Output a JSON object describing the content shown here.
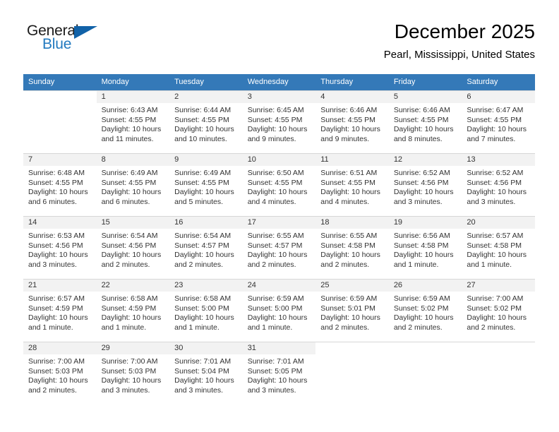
{
  "brand": {
    "name_top": "General",
    "name_bottom": "Blue",
    "accent_color": "#1162a8",
    "blue_text_color": "#2179bf"
  },
  "header": {
    "title": "December 2025",
    "subtitle": "Pearl, Mississippi, United States"
  },
  "calendar": {
    "header_bg": "#3479b8",
    "header_text_color": "#ffffff",
    "daynum_bg": "#f2f2f2",
    "weekday_headers": [
      "Sunday",
      "Monday",
      "Tuesday",
      "Wednesday",
      "Thursday",
      "Friday",
      "Saturday"
    ],
    "weeks": [
      [
        {
          "day": "",
          "lines": []
        },
        {
          "day": "1",
          "lines": [
            "Sunrise: 6:43 AM",
            "Sunset: 4:55 PM",
            "Daylight: 10 hours",
            "and 11 minutes."
          ]
        },
        {
          "day": "2",
          "lines": [
            "Sunrise: 6:44 AM",
            "Sunset: 4:55 PM",
            "Daylight: 10 hours",
            "and 10 minutes."
          ]
        },
        {
          "day": "3",
          "lines": [
            "Sunrise: 6:45 AM",
            "Sunset: 4:55 PM",
            "Daylight: 10 hours",
            "and 9 minutes."
          ]
        },
        {
          "day": "4",
          "lines": [
            "Sunrise: 6:46 AM",
            "Sunset: 4:55 PM",
            "Daylight: 10 hours",
            "and 9 minutes."
          ]
        },
        {
          "day": "5",
          "lines": [
            "Sunrise: 6:46 AM",
            "Sunset: 4:55 PM",
            "Daylight: 10 hours",
            "and 8 minutes."
          ]
        },
        {
          "day": "6",
          "lines": [
            "Sunrise: 6:47 AM",
            "Sunset: 4:55 PM",
            "Daylight: 10 hours",
            "and 7 minutes."
          ]
        }
      ],
      [
        {
          "day": "7",
          "lines": [
            "Sunrise: 6:48 AM",
            "Sunset: 4:55 PM",
            "Daylight: 10 hours",
            "and 6 minutes."
          ]
        },
        {
          "day": "8",
          "lines": [
            "Sunrise: 6:49 AM",
            "Sunset: 4:55 PM",
            "Daylight: 10 hours",
            "and 6 minutes."
          ]
        },
        {
          "day": "9",
          "lines": [
            "Sunrise: 6:49 AM",
            "Sunset: 4:55 PM",
            "Daylight: 10 hours",
            "and 5 minutes."
          ]
        },
        {
          "day": "10",
          "lines": [
            "Sunrise: 6:50 AM",
            "Sunset: 4:55 PM",
            "Daylight: 10 hours",
            "and 4 minutes."
          ]
        },
        {
          "day": "11",
          "lines": [
            "Sunrise: 6:51 AM",
            "Sunset: 4:55 PM",
            "Daylight: 10 hours",
            "and 4 minutes."
          ]
        },
        {
          "day": "12",
          "lines": [
            "Sunrise: 6:52 AM",
            "Sunset: 4:56 PM",
            "Daylight: 10 hours",
            "and 3 minutes."
          ]
        },
        {
          "day": "13",
          "lines": [
            "Sunrise: 6:52 AM",
            "Sunset: 4:56 PM",
            "Daylight: 10 hours",
            "and 3 minutes."
          ]
        }
      ],
      [
        {
          "day": "14",
          "lines": [
            "Sunrise: 6:53 AM",
            "Sunset: 4:56 PM",
            "Daylight: 10 hours",
            "and 3 minutes."
          ]
        },
        {
          "day": "15",
          "lines": [
            "Sunrise: 6:54 AM",
            "Sunset: 4:56 PM",
            "Daylight: 10 hours",
            "and 2 minutes."
          ]
        },
        {
          "day": "16",
          "lines": [
            "Sunrise: 6:54 AM",
            "Sunset: 4:57 PM",
            "Daylight: 10 hours",
            "and 2 minutes."
          ]
        },
        {
          "day": "17",
          "lines": [
            "Sunrise: 6:55 AM",
            "Sunset: 4:57 PM",
            "Daylight: 10 hours",
            "and 2 minutes."
          ]
        },
        {
          "day": "18",
          "lines": [
            "Sunrise: 6:55 AM",
            "Sunset: 4:58 PM",
            "Daylight: 10 hours",
            "and 2 minutes."
          ]
        },
        {
          "day": "19",
          "lines": [
            "Sunrise: 6:56 AM",
            "Sunset: 4:58 PM",
            "Daylight: 10 hours",
            "and 1 minute."
          ]
        },
        {
          "day": "20",
          "lines": [
            "Sunrise: 6:57 AM",
            "Sunset: 4:58 PM",
            "Daylight: 10 hours",
            "and 1 minute."
          ]
        }
      ],
      [
        {
          "day": "21",
          "lines": [
            "Sunrise: 6:57 AM",
            "Sunset: 4:59 PM",
            "Daylight: 10 hours",
            "and 1 minute."
          ]
        },
        {
          "day": "22",
          "lines": [
            "Sunrise: 6:58 AM",
            "Sunset: 4:59 PM",
            "Daylight: 10 hours",
            "and 1 minute."
          ]
        },
        {
          "day": "23",
          "lines": [
            "Sunrise: 6:58 AM",
            "Sunset: 5:00 PM",
            "Daylight: 10 hours",
            "and 1 minute."
          ]
        },
        {
          "day": "24",
          "lines": [
            "Sunrise: 6:59 AM",
            "Sunset: 5:00 PM",
            "Daylight: 10 hours",
            "and 1 minute."
          ]
        },
        {
          "day": "25",
          "lines": [
            "Sunrise: 6:59 AM",
            "Sunset: 5:01 PM",
            "Daylight: 10 hours",
            "and 2 minutes."
          ]
        },
        {
          "day": "26",
          "lines": [
            "Sunrise: 6:59 AM",
            "Sunset: 5:02 PM",
            "Daylight: 10 hours",
            "and 2 minutes."
          ]
        },
        {
          "day": "27",
          "lines": [
            "Sunrise: 7:00 AM",
            "Sunset: 5:02 PM",
            "Daylight: 10 hours",
            "and 2 minutes."
          ]
        }
      ],
      [
        {
          "day": "28",
          "lines": [
            "Sunrise: 7:00 AM",
            "Sunset: 5:03 PM",
            "Daylight: 10 hours",
            "and 2 minutes."
          ]
        },
        {
          "day": "29",
          "lines": [
            "Sunrise: 7:00 AM",
            "Sunset: 5:03 PM",
            "Daylight: 10 hours",
            "and 3 minutes."
          ]
        },
        {
          "day": "30",
          "lines": [
            "Sunrise: 7:01 AM",
            "Sunset: 5:04 PM",
            "Daylight: 10 hours",
            "and 3 minutes."
          ]
        },
        {
          "day": "31",
          "lines": [
            "Sunrise: 7:01 AM",
            "Sunset: 5:05 PM",
            "Daylight: 10 hours",
            "and 3 minutes."
          ]
        },
        {
          "day": "",
          "lines": []
        },
        {
          "day": "",
          "lines": []
        },
        {
          "day": "",
          "lines": []
        }
      ]
    ]
  }
}
